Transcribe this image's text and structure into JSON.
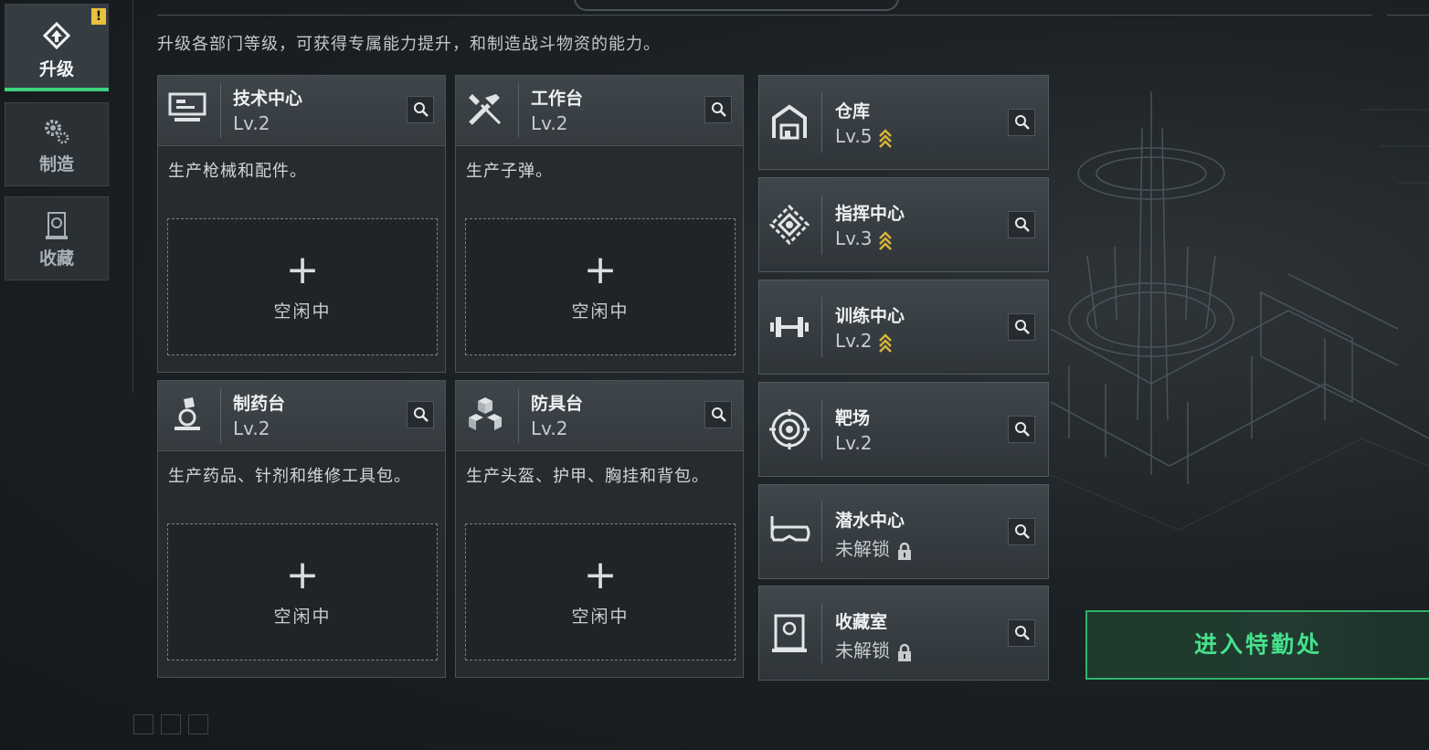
{
  "sidebar": {
    "tabs": [
      {
        "label": "升级",
        "icon": "upgrade-icon",
        "active": true,
        "badge": "!"
      },
      {
        "label": "制造",
        "icon": "gears-icon",
        "active": false
      },
      {
        "label": "收藏",
        "icon": "trophy-icon",
        "active": false
      }
    ]
  },
  "subtitle": "升级各部门等级，可获得专属能力提升，和制造战斗物资的能力。",
  "production": [
    {
      "name": "技术中心",
      "level": "Lv.2",
      "desc": "生产枪械和配件。",
      "slot_plus": "+",
      "slot_status": "空闲中",
      "icon": "monitor-icon"
    },
    {
      "name": "工作台",
      "level": "Lv.2",
      "desc": "生产子弹。",
      "slot_plus": "+",
      "slot_status": "空闲中",
      "icon": "tools-icon"
    },
    {
      "name": "制药台",
      "level": "Lv.2",
      "desc": "生产药品、针剂和维修工具包。",
      "slot_plus": "+",
      "slot_status": "空闲中",
      "icon": "microscope-icon"
    },
    {
      "name": "防具台",
      "level": "Lv.2",
      "desc": "生产头盔、护甲、胸挂和背包。",
      "slot_plus": "+",
      "slot_status": "空闲中",
      "icon": "armor-cubes-icon"
    }
  ],
  "facilities": [
    {
      "name": "仓库",
      "level": "Lv.5",
      "upgradable": true,
      "locked": false,
      "icon": "warehouse-icon"
    },
    {
      "name": "指挥中心",
      "level": "Lv.3",
      "upgradable": true,
      "locked": false,
      "icon": "command-icon"
    },
    {
      "name": "训练中心",
      "level": "Lv.2",
      "upgradable": true,
      "locked": false,
      "icon": "dumbbell-icon"
    },
    {
      "name": "靶场",
      "level": "Lv.2",
      "upgradable": false,
      "locked": false,
      "icon": "target-icon"
    },
    {
      "name": "潜水中心",
      "level": "未解锁",
      "upgradable": false,
      "locked": true,
      "icon": "diving-mask-icon"
    },
    {
      "name": "收藏室",
      "level": "未解锁",
      "upgradable": false,
      "locked": true,
      "icon": "showcase-icon"
    }
  ],
  "enter_button": "进入特勤处",
  "colors": {
    "accent": "#3fd27f",
    "upgrade_arrow": "#d9b43a",
    "warning": "#e7c23a"
  }
}
